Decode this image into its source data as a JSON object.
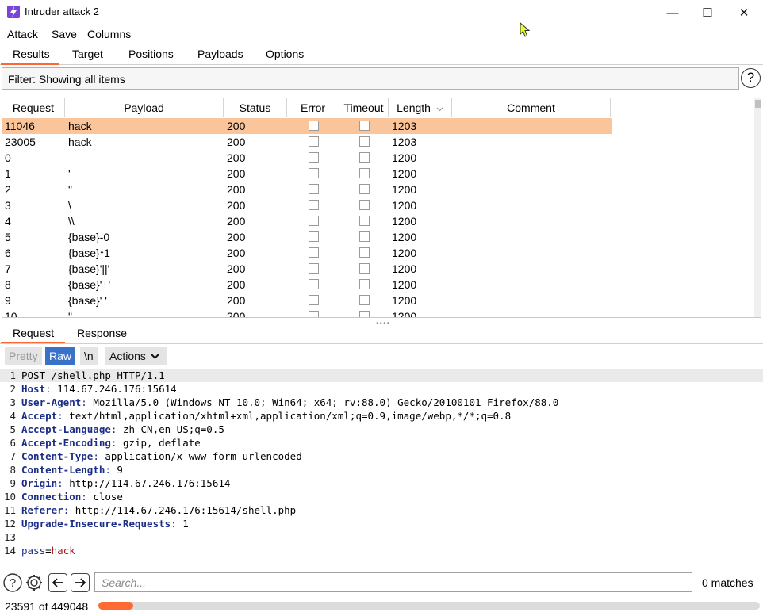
{
  "window": {
    "title": "Intruder attack 2",
    "minimize": "—",
    "maximize": "☐",
    "close": "✕",
    "icon": "burp-bolt-icon",
    "accent": "#ff6633"
  },
  "menu": [
    "Attack",
    "Save",
    "Columns"
  ],
  "top_tabs": [
    "Results",
    "Target",
    "Positions",
    "Payloads",
    "Options"
  ],
  "filter": {
    "label": "Filter: Showing all items",
    "help": "?"
  },
  "table": {
    "columns": [
      "Request",
      "Payload",
      "Status",
      "Error",
      "Timeout",
      "Length",
      "Comment"
    ],
    "sort_column": "Length",
    "rows": [
      {
        "request": "11046",
        "payload": "hack",
        "status": "200",
        "length": "1203",
        "selected": true
      },
      {
        "request": "23005",
        "payload": "hack",
        "status": "200",
        "length": "1203"
      },
      {
        "request": "0",
        "payload": "",
        "status": "200",
        "length": "1200"
      },
      {
        "request": "1",
        "payload": "'",
        "status": "200",
        "length": "1200"
      },
      {
        "request": "2",
        "payload": "\"",
        "status": "200",
        "length": "1200"
      },
      {
        "request": "3",
        "payload": "\\",
        "status": "200",
        "length": "1200"
      },
      {
        "request": "4",
        "payload": "\\\\",
        "status": "200",
        "length": "1200"
      },
      {
        "request": "5",
        "payload": "{base}-0",
        "status": "200",
        "length": "1200"
      },
      {
        "request": "6",
        "payload": "{base}*1",
        "status": "200",
        "length": "1200"
      },
      {
        "request": "7",
        "payload": "{base}'||'",
        "status": "200",
        "length": "1200"
      },
      {
        "request": "8",
        "payload": "{base}'+'",
        "status": "200",
        "length": "1200"
      },
      {
        "request": "9",
        "payload": "{base}' '",
        "status": "200",
        "length": "1200"
      },
      {
        "request": "10",
        "payload": "\"",
        "status": "200",
        "length": "1200"
      }
    ]
  },
  "detail_tabs": [
    "Request",
    "Response"
  ],
  "toolbar": {
    "pretty": "Pretty",
    "raw": "Raw",
    "newline": "\\n",
    "actions": "Actions"
  },
  "request_lines": [
    {
      "n": "1",
      "plain": "POST /shell.php HTTP/1.1"
    },
    {
      "n": "2",
      "key": "Host",
      "val": " 114.67.246.176:15614"
    },
    {
      "n": "3",
      "key": "User-Agent",
      "val": " Mozilla/5.0 (Windows NT 10.0; Win64; x64; rv:88.0) Gecko/20100101 Firefox/88.0"
    },
    {
      "n": "4",
      "key": "Accept",
      "val": " text/html,application/xhtml+xml,application/xml;q=0.9,image/webp,*/*;q=0.8"
    },
    {
      "n": "5",
      "key": "Accept-Language",
      "val": " zh-CN,en-US;q=0.5"
    },
    {
      "n": "6",
      "key": "Accept-Encoding",
      "val": " gzip, deflate"
    },
    {
      "n": "7",
      "key": "Content-Type",
      "val": " application/x-www-form-urlencoded"
    },
    {
      "n": "8",
      "key": "Content-Length",
      "val": " 9"
    },
    {
      "n": "9",
      "key": "Origin",
      "val": " http://114.67.246.176:15614"
    },
    {
      "n": "10",
      "key": "Connection",
      "val": " close"
    },
    {
      "n": "11",
      "key": "Referer",
      "val": " http://114.67.246.176:15614/shell.php"
    },
    {
      "n": "12",
      "key": "Upgrade-Insecure-Requests",
      "val": " 1"
    },
    {
      "n": "13",
      "plain": ""
    },
    {
      "n": "14",
      "param": "pass",
      "eq": "=",
      "pval": "hack"
    }
  ],
  "search": {
    "placeholder": "Search...",
    "matches": "0 matches"
  },
  "status": {
    "text": "23591 of 449048",
    "progress_fraction": 0.0525
  }
}
